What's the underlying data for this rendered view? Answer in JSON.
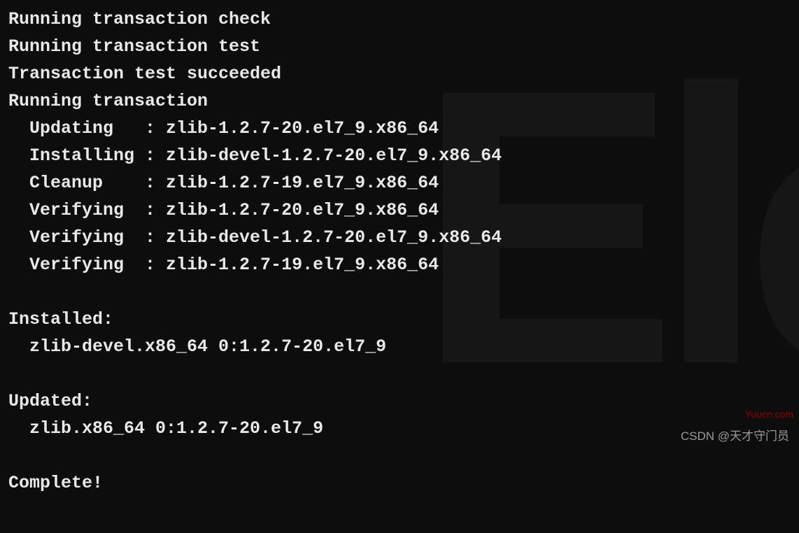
{
  "terminal": {
    "lines": [
      "Running transaction check",
      "Running transaction test",
      "Transaction test succeeded",
      "Running transaction",
      "  Updating   : zlib-1.2.7-20.el7_9.x86_64",
      "  Installing : zlib-devel-1.2.7-20.el7_9.x86_64",
      "  Cleanup    : zlib-1.2.7-19.el7_9.x86_64",
      "  Verifying  : zlib-1.2.7-20.el7_9.x86_64",
      "  Verifying  : zlib-devel-1.2.7-20.el7_9.x86_64",
      "  Verifying  : zlib-1.2.7-19.el7_9.x86_64",
      "",
      "Installed:",
      "  zlib-devel.x86_64 0:1.2.7-20.el7_9",
      "",
      "Updated:",
      "  zlib.x86_64 0:1.2.7-20.el7_9",
      "",
      "Complete!"
    ]
  },
  "watermark": {
    "site": "Yuucn.com",
    "attribution": "CSDN @天才守门员"
  },
  "background": {
    "glyph": "Ele"
  }
}
